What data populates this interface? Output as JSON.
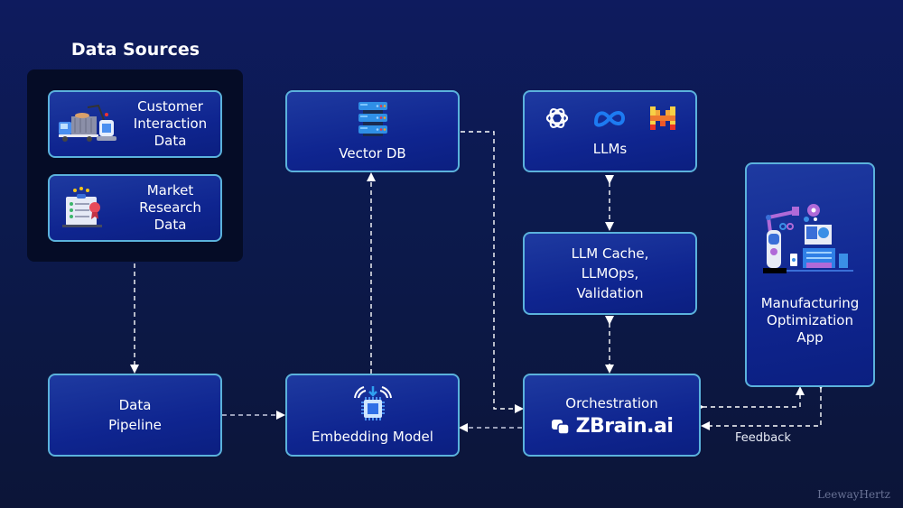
{
  "diagram": {
    "title": "Data Sources",
    "sources": [
      {
        "label": "Customer\nInteraction\nData",
        "icon": "truck-loading-icon"
      },
      {
        "label": "Market\nResearch\nData",
        "icon": "clipboard-report-icon"
      }
    ],
    "nodes": {
      "vector_db": {
        "label": "Vector DB",
        "icon": "server-stack-icon"
      },
      "llms": {
        "label": "LLMs",
        "icons": [
          "openai-icon",
          "meta-icon",
          "mistral-icon"
        ]
      },
      "llm_cache": {
        "label": "LLM Cache,\nLLMOps,\nValidation"
      },
      "app": {
        "label": "Manufacturing\nOptimization\nApp",
        "icon": "robot-arm-factory-icon"
      },
      "pipeline": {
        "label": "Data\nPipeline"
      },
      "embedding": {
        "label": "Embedding Model",
        "icon": "chip-icon"
      },
      "orchestration": {
        "label": "Orchestration",
        "brand": "ZBrain.ai"
      }
    },
    "edges": [
      {
        "from": "Data Sources",
        "to": "Data Pipeline",
        "style": "dashed"
      },
      {
        "from": "Data Pipeline",
        "to": "Embedding Model",
        "style": "dashed"
      },
      {
        "from": "Embedding Model",
        "to": "Vector DB",
        "style": "dashed"
      },
      {
        "from": "Vector DB",
        "to": "Orchestration",
        "style": "dashed"
      },
      {
        "from": "Orchestration",
        "to": "Embedding Model",
        "style": "dashed"
      },
      {
        "from": "LLMs",
        "to": "LLM Cache, LLMOps, Validation",
        "style": "dashed-bidirectional"
      },
      {
        "from": "LLM Cache, LLMOps, Validation",
        "to": "Orchestration",
        "style": "dashed-bidirectional"
      },
      {
        "from": "Orchestration",
        "to": "Manufacturing Optimization App",
        "style": "dashed-bidirectional"
      },
      {
        "from": "Manufacturing Optimization App",
        "to": "Orchestration",
        "style": "dashed",
        "label": "Feedback"
      }
    ],
    "feedback_label": "Feedback",
    "watermark": "LeewayHertz",
    "colors": {
      "background_top": "#0e1b5e",
      "background_bottom": "#0c1538",
      "node_fill": "#0f2590",
      "node_border": "#5bb2dc",
      "panel": "#050c26",
      "connector": "#ffffff"
    }
  }
}
